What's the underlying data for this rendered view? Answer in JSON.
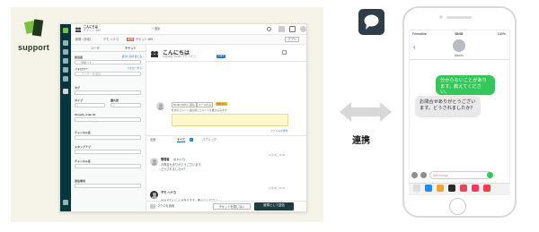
{
  "brand": {
    "logo_text": "support"
  },
  "agent_ui": {
    "top_tabs": [
      "新規（作成）",
      "デモ ハナコ",
      "チケット #59"
    ],
    "new_tab_label": "+ 追加",
    "top_tab_badge": "新規",
    "apps_button": "アプリ",
    "left_panel": {
      "tabs": [
        "ユーザ",
        "チケット"
      ],
      "assignee_label": "担当者",
      "assignee_link": "自分に割り当てる",
      "assignee_value": "サポート",
      "followers_label": "フォロワー",
      "followers_link": "フォローする",
      "followers_placeholder": "ユーザーを追加",
      "tags_label": "タグ",
      "type_label": "タイプ",
      "priority_label": "優先度",
      "type_value": "-",
      "priority_value": "-",
      "shopify_label": "Shopify order ID",
      "channel_label": "チャンネル名",
      "stamp_label": "スタンプアプ",
      "channel_label_2": "チャンネル名",
      "dest_label": "送信専用"
    },
    "ticket": {
      "title": "こんにちは",
      "meta": "11月18日 16:08 • デモ ハナコ",
      "meta_tag": "公開中",
      "composer_tags": [
        "Media SMS に返信",
        "メールのみ",
        "当社から"
      ],
      "composer_hint": "社内のコメント返信用にコメントを書き込みます",
      "composer_link": "ファイルの添付",
      "filters": [
        "全部",
        "すべて",
        "パブリック"
      ],
      "filter_count": "2",
      "comments": [
        {
          "author": "管理者",
          "badge": "(社内メモ)",
          "time": "11月18日 16:08",
          "lines": [
            "お問合せありがとうございます。",
            "どうされましたか？"
          ]
        },
        {
          "author": "デモ ハナコ",
          "badge": "",
          "time": "11月18日 16:09",
          "lines": [
            "分からないことがあります。教えてください。"
          ]
        }
      ]
    },
    "bottom": {
      "macro_label": "マクロを適用",
      "close_label": "チケットを閉じない",
      "submit_label": "新規として送信"
    }
  },
  "middle": {
    "label": "連携"
  },
  "phone": {
    "status_carrier": "Friendible",
    "status_time": "15:05",
    "status_battery": "100%",
    "contact_name": "Admin",
    "bubbles": [
      {
        "side": "right",
        "text": "分からないことがあります。教えてください。"
      },
      {
        "side": "left",
        "text": "お問合せありがとうございます。どうされましたか？"
      }
    ],
    "input_placeholder": "iMessage"
  },
  "colors": {
    "nav": "#03363d",
    "beige": "#f6f3e8",
    "green_bubble": "#34c759",
    "yellow_composer": "#fff8c8"
  }
}
